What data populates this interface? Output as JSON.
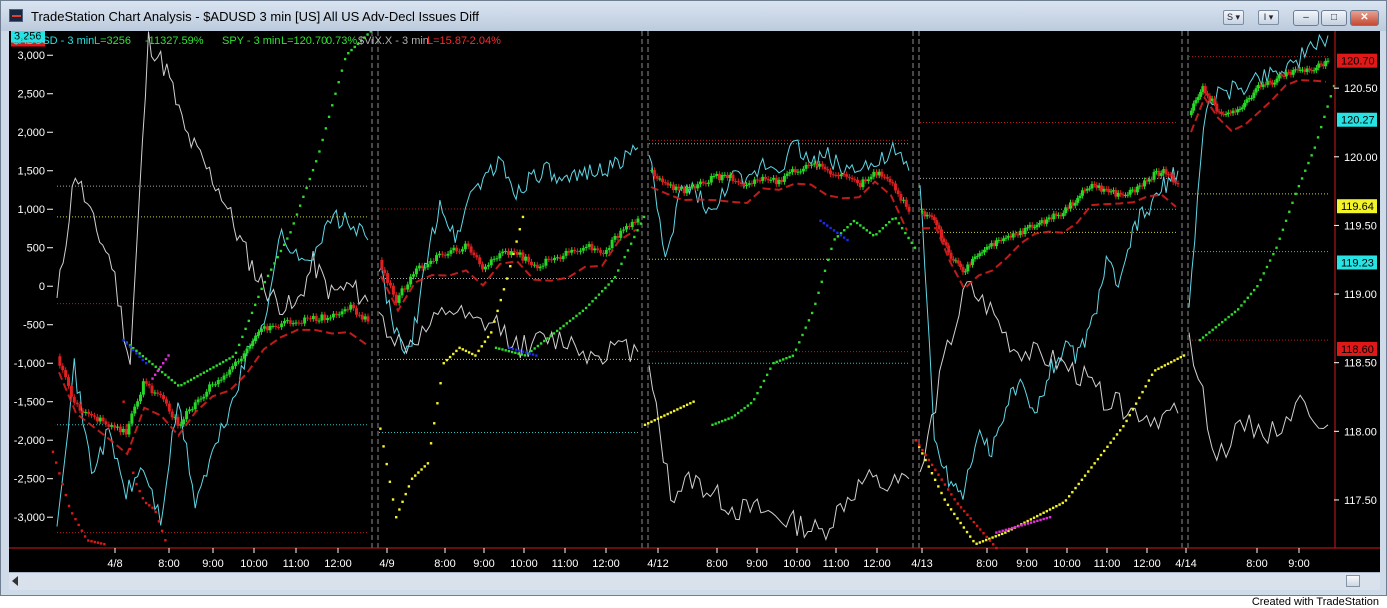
{
  "window": {
    "title": "TradeStation Chart Analysis - $ADUSD 3 min [US] All US Adv-Decl Issues Diff",
    "button_s": "S ▾",
    "button_i": "I ▾",
    "minimize": "–",
    "maximize": "□",
    "close": "✕"
  },
  "footer": {
    "credit": "Created with TradeStation"
  },
  "legend": {
    "adusd_name": "$ADUSD - 3 min",
    "adusd_last": "L=3256",
    "adusd_chg": "-11327.59%",
    "spy_name": "SPY - 3 min",
    "spy_last": "L=120.70",
    "spy_chg": "0.73%",
    "vix_name": "$VIX.X - 3 min",
    "vix_last": "L=15.87",
    "vix_chg": "-2.04%"
  },
  "colors": {
    "background": "#000000",
    "adusd_line": "#5fd7e6",
    "spy_up": "#27d827",
    "spy_down": "#e02020",
    "vix_line": "#d0d0d0",
    "green_dots": "#2ddc2d",
    "red_dots": "#e01818",
    "yellow_dots": "#f3f32a",
    "magenta_dots": "#e030e0",
    "blue_dots": "#1c2cf0",
    "white_dots": "#ffffff",
    "legend_cyan": "#27e3e3",
    "legend_green": "#2ee52e",
    "legend_red": "#ff2a2a",
    "legend_gray": "#b0b0b0"
  },
  "chart_data": {
    "type": "line",
    "title": "",
    "xlabel": "",
    "ylabel": "",
    "days": [
      "4/8",
      "4/9",
      "4/12",
      "4/13",
      "4/14"
    ],
    "x_ticks": [
      "4/8",
      "8:00",
      "9:00",
      "10:00",
      "11:00",
      "12:00",
      "4/9",
      "8:00",
      "9:00",
      "10:00",
      "11:00",
      "12:00",
      "4/12",
      "8:00",
      "9:00",
      "10:00",
      "11:00",
      "12:00",
      "4/13",
      "8:00",
      "9:00",
      "10:00",
      "11:00",
      "12:00",
      "4/14",
      "8:00",
      "9:00"
    ],
    "left_axis": {
      "label": "$ADUSD",
      "ylim": [
        -3400,
        3250
      ],
      "ticks": [
        3000,
        2500,
        2000,
        1500,
        1000,
        500,
        0,
        -500,
        -1000,
        -1500,
        -2000,
        -2500,
        -3000
      ],
      "tick_labels": [
        "3,000",
        "2,500",
        "2,000",
        "1,500",
        "1,000",
        "500",
        "0",
        "-500",
        "-1,000",
        "-1,500",
        "-2,000",
        "-2,500",
        "-3,000"
      ],
      "last_value_label": "3,256"
    },
    "right_axis": {
      "label": "SPY",
      "ylim": [
        117.15,
        120.88
      ],
      "ticks": [
        120.5,
        120.0,
        119.5,
        119.0,
        118.5,
        118.0,
        117.5
      ],
      "tick_labels": [
        "120.50",
        "120.00",
        "119.50",
        "119.00",
        "118.50",
        "118.00",
        "117.50"
      ],
      "markers": [
        {
          "label": "120.70",
          "value": 120.7,
          "bg": "#e01818",
          "fg": "#000000"
        },
        {
          "label": "120.27",
          "value": 120.27,
          "bg": "#27e3e3",
          "fg": "#000000"
        },
        {
          "label": "119.64",
          "value": 119.64,
          "bg": "#f3f32a",
          "fg": "#000000"
        },
        {
          "label": "119.23",
          "value": 119.23,
          "bg": "#27e3e3",
          "fg": "#000000"
        },
        {
          "label": "118.60",
          "value": 118.6,
          "bg": "#e01818",
          "fg": "#000000"
        }
      ]
    },
    "series": [
      {
        "name": "$ADUSD - 3 min",
        "axis": "left",
        "values": [
          [
            -3000,
            -1050,
            -2400,
            -1900,
            -2700,
            -2350,
            -3050,
            -1500,
            -2800,
            -2200,
            -1600,
            -900,
            -400,
            700,
            300,
            500,
            900,
            800,
            600
          ],
          [
            300,
            -600,
            -900,
            200,
            1100,
            600,
            1200,
            1450,
            1600,
            1200,
            1450,
            1500,
            1300,
            1400,
            1550,
            1500,
            1650,
            1800
          ],
          [
            1800,
            250,
            1300,
            1200,
            900,
            1450,
            1300,
            1600,
            1550,
            1850,
            1600,
            1700,
            1500,
            1600,
            1550,
            1750,
            1500
          ],
          [
            1400,
            -2000,
            -2500,
            -2700,
            -1900,
            -2200,
            -1500,
            -1300,
            -1700,
            -1100,
            -800,
            -900,
            -500,
            300,
            0,
            800,
            1000,
            1300,
            1500
          ],
          [
            -200,
            2400,
            2500,
            2600,
            2700,
            2800,
            2900,
            3050,
            3256
          ]
        ]
      },
      {
        "name": "SPY - 3 min",
        "axis": "right",
        "values": [
          [
            118.55,
            118.2,
            118.1,
            118.05,
            118.0,
            118.35,
            118.25,
            118.05,
            118.2,
            118.35,
            118.45,
            118.6,
            118.75,
            118.78,
            118.8,
            118.82,
            118.85,
            118.9,
            118.8
          ],
          [
            119.25,
            118.95,
            119.15,
            119.25,
            119.3,
            119.35,
            119.2,
            119.3,
            119.3,
            119.2,
            119.25,
            119.3,
            119.35,
            119.3,
            119.45,
            119.55
          ],
          [
            119.9,
            119.8,
            119.75,
            119.8,
            119.85,
            119.85,
            119.8,
            119.85,
            119.82,
            119.9,
            119.95,
            119.9,
            119.85,
            119.8,
            119.88,
            119.8,
            119.6
          ],
          [
            119.6,
            119.55,
            119.3,
            119.15,
            119.3,
            119.35,
            119.4,
            119.45,
            119.5,
            119.55,
            119.6,
            119.7,
            119.8,
            119.75,
            119.72,
            119.75,
            119.85,
            119.9,
            119.8
          ],
          [
            120.3,
            120.5,
            120.35,
            120.3,
            120.4,
            120.5,
            120.55,
            120.6,
            120.62,
            120.65,
            120.7
          ]
        ]
      },
      {
        "name": "$VIX.X - 3 min",
        "axis": "left",
        "values": [
          [
            -200,
            1500,
            800,
            300,
            -1000,
            3200,
            2800,
            2000,
            1600,
            1200,
            600,
            100,
            -200,
            -300,
            300,
            -100,
            0,
            -200
          ],
          [
            -400,
            -800,
            -600,
            -300,
            -500,
            -500,
            -800,
            -700,
            -700,
            -900,
            -800,
            -850
          ],
          [
            -1100,
            -2700,
            -2500,
            -2700,
            -2900,
            -2900,
            -3000,
            -3100,
            -3200,
            -2800,
            -2500,
            -2600,
            -2500
          ],
          [
            -2500,
            -1000,
            0,
            -300,
            -800,
            -900,
            -1000,
            -1200,
            -1500,
            -1600,
            -1700,
            -1650
          ],
          [
            -700,
            -2200,
            -1800,
            -1900,
            -1500,
            -1800
          ]
        ]
      }
    ],
    "annotations": [
      "dotted indicator (green / red / yellow / magenta / blue / white)",
      "dashed day separators",
      "horizontal reference lines per session"
    ],
    "grid": false,
    "legend_position": "top-left"
  }
}
